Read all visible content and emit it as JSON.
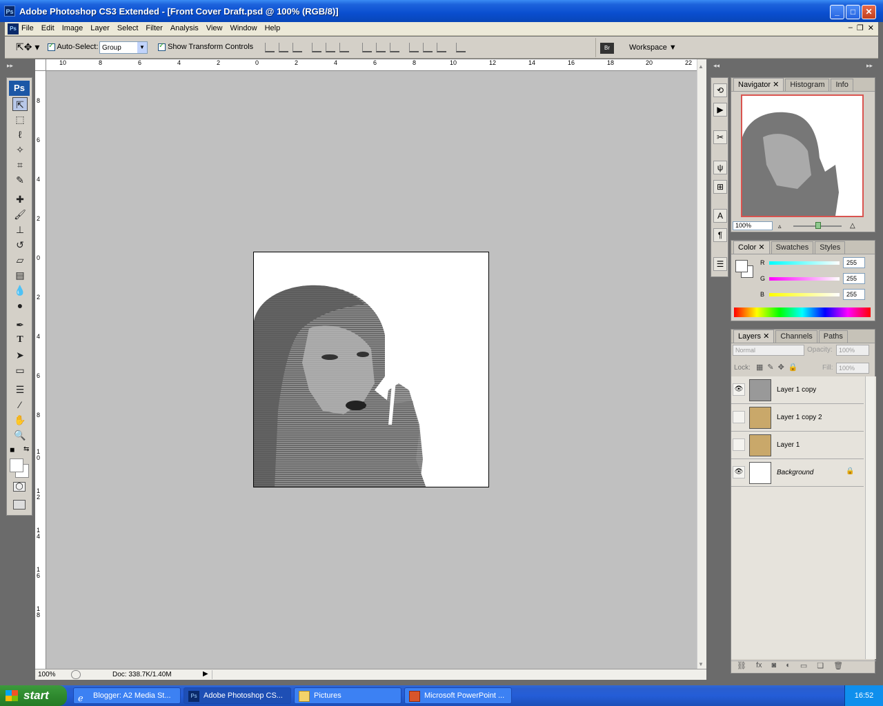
{
  "window": {
    "title": "Adobe Photoshop CS3 Extended - [Front Cover Draft.psd @ 100% (RGB/8)]",
    "app_icon": "Ps"
  },
  "menu": [
    "File",
    "Edit",
    "Image",
    "Layer",
    "Select",
    "Filter",
    "Analysis",
    "View",
    "Window",
    "Help"
  ],
  "options_bar": {
    "auto_select_label": "Auto-Select:",
    "auto_select_value": "Group",
    "show_transform_label": "Show Transform Controls",
    "workspace_label": "Workspace"
  },
  "toolbox": {
    "logo": "Ps"
  },
  "ruler": {
    "h_ticks": [
      "10",
      "8",
      "6",
      "4",
      "2",
      "0",
      "2",
      "4",
      "6",
      "8",
      "10",
      "12",
      "14",
      "16",
      "18",
      "20",
      "22"
    ],
    "v_ticks": [
      "8",
      "6",
      "4",
      "2",
      "0",
      "2",
      "4",
      "6",
      "8",
      "1 0",
      "1 2",
      "1 4",
      "1 6",
      "1 8"
    ]
  },
  "status": {
    "zoom": "100%",
    "doc": "Doc: 338.7K/1.40M"
  },
  "navigator": {
    "tabs": [
      "Navigator",
      "Histogram",
      "Info"
    ],
    "zoom": "100%"
  },
  "color_panel": {
    "tabs": [
      "Color",
      "Swatches",
      "Styles"
    ],
    "channels": [
      {
        "label": "R",
        "value": "255"
      },
      {
        "label": "G",
        "value": "255"
      },
      {
        "label": "B",
        "value": "255"
      }
    ]
  },
  "layers_panel": {
    "tabs": [
      "Layers",
      "Channels",
      "Paths"
    ],
    "blend_mode": "Normal",
    "opacity_label": "Opacity:",
    "opacity_value": "100%",
    "lock_label": "Lock:",
    "fill_label": "Fill:",
    "fill_value": "100%",
    "layers": [
      {
        "name": "Layer 1 copy",
        "visible": true
      },
      {
        "name": "Layer 1 copy 2",
        "visible": false
      },
      {
        "name": "Layer 1",
        "visible": false
      },
      {
        "name": "Background",
        "visible": true
      }
    ]
  },
  "taskbar": {
    "start": "start",
    "tasks": [
      {
        "label": "Blogger: A2 Media St..."
      },
      {
        "label": "Adobe Photoshop CS..."
      },
      {
        "label": "Pictures"
      },
      {
        "label": "Microsoft PowerPoint ..."
      }
    ],
    "clock": "16:52"
  }
}
